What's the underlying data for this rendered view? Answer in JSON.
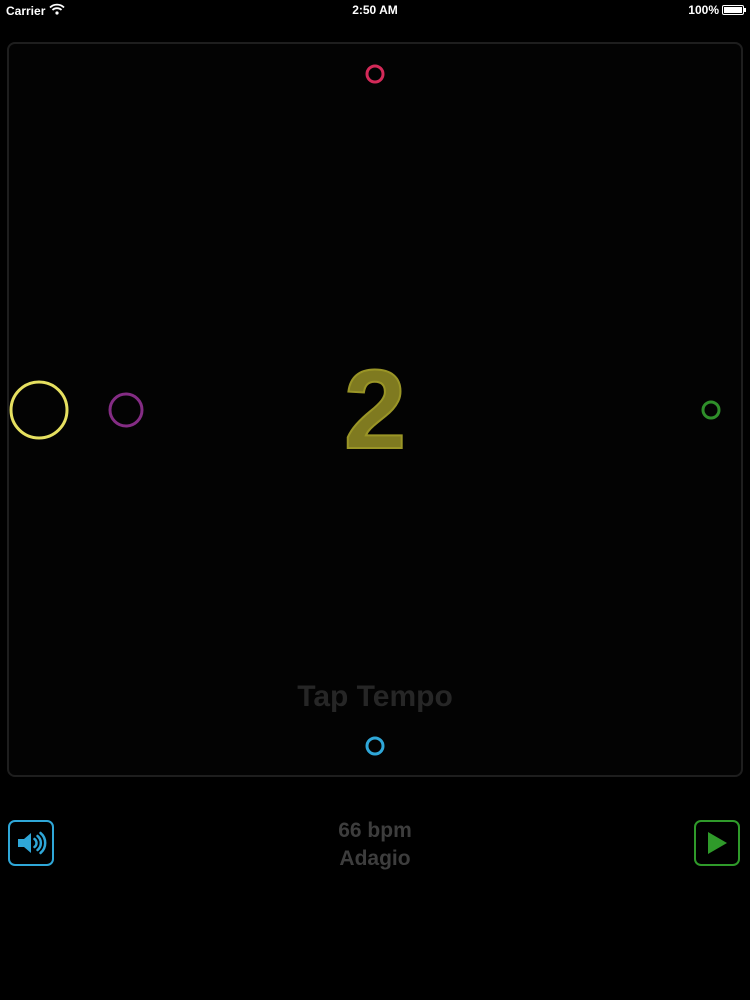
{
  "status_bar": {
    "carrier": "Carrier",
    "time": "2:50 AM",
    "battery": "100%",
    "battery_level": 1.0,
    "wifi_icon": "wifi-icon",
    "battery_icon": "battery-icon"
  },
  "metronome": {
    "beat_number": "2",
    "tap_tempo_label": "Tap Tempo",
    "bpm_label": "66 bpm",
    "tempo_marking": "Adagio",
    "beat_colors": {
      "top": "#d42a59",
      "right": "#2f8f2a",
      "bottom": "#2fa7d8",
      "left": "#842c84",
      "active": "#e6e060"
    },
    "beat_number_color": "#7f7a20"
  },
  "controls": {
    "sound_button_icon": "speaker-icon",
    "sound_button_color": "#2fa7d8",
    "play_button_icon": "play-icon",
    "play_button_color": "#2f9a2a"
  }
}
